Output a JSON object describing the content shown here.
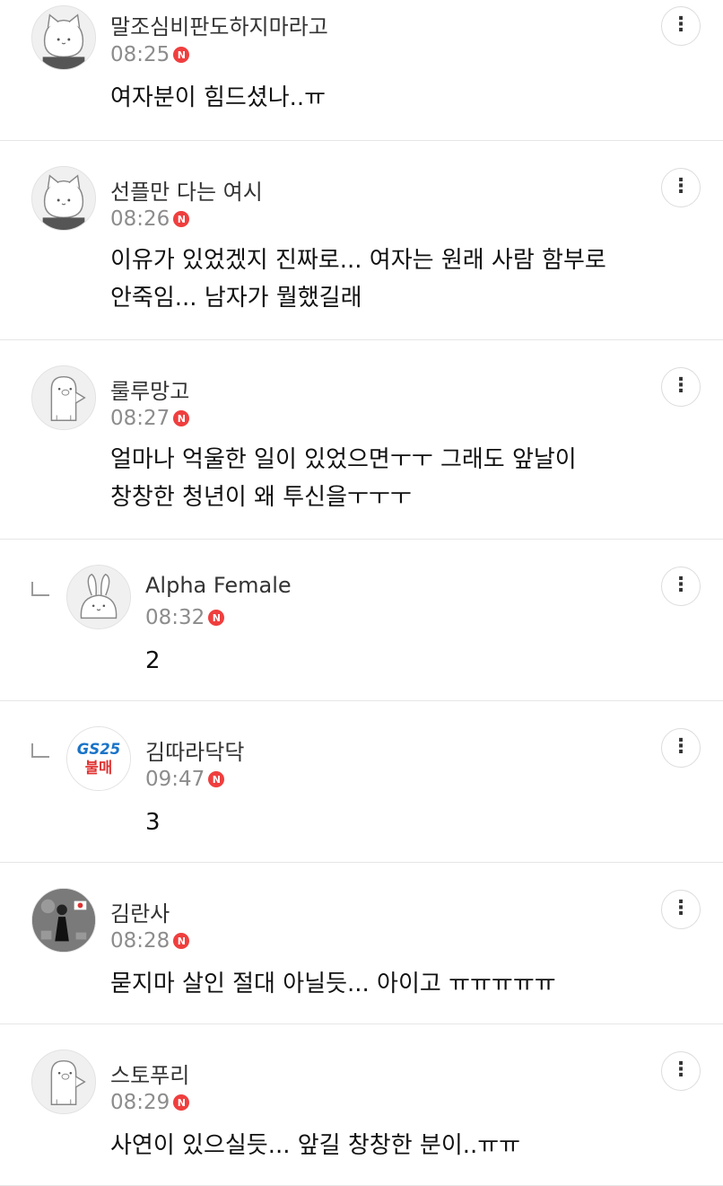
{
  "comments": [
    {
      "nickname": "말조심비판도하지마라고",
      "time": "08:25",
      "badge": "N",
      "text": "여자분이 힘드셨나..ㅠ",
      "avatar": "cat-avatar-icon",
      "reply": false
    },
    {
      "nickname": "선플만 다는 여시",
      "time": "08:26",
      "badge": "N",
      "text": "이유가 있었겠지 진짜로... 여자는 원래 사람 함부로\n안죽임... 남자가 뭘했길래",
      "avatar": "cat-avatar-icon",
      "reply": false
    },
    {
      "nickname": "룰루망고",
      "time": "08:27",
      "badge": "N",
      "text": "얼마나 억울한 일이 있었으면ㅜㅜ 그래도 앞날이\n창창한 청년이 왜 투신을ㅜㅜㅜ",
      "avatar": "pig-avatar-icon",
      "reply": false
    },
    {
      "nickname": "Alpha Female",
      "time": "08:32",
      "badge": "N",
      "text": "2",
      "avatar": "bunny-avatar-icon",
      "reply": true
    },
    {
      "nickname": "김따라닥닥",
      "time": "09:47",
      "badge": "N",
      "text": "3",
      "avatar": "gs25-avatar-icon",
      "avatar_text": [
        "GS25",
        "불매"
      ],
      "reply": true
    },
    {
      "nickname": "김란사",
      "time": "08:28",
      "badge": "N",
      "text": "묻지마 살인 절대 아닐듯... 아이고 ㅠㅠㅠㅠㅠ",
      "avatar": "photo-avatar-icon",
      "reply": false
    },
    {
      "nickname": "스토푸리",
      "time": "08:29",
      "badge": "N",
      "text": "사연이 있으실듯... 앞길 창창한 분이..ㅠㅠ",
      "avatar": "pig-avatar-icon",
      "reply": false
    }
  ],
  "more_icon": "⋮",
  "colors": {
    "badge": "#f03e3e",
    "time": "#8c8c8c",
    "divider": "#e6e6e6"
  }
}
